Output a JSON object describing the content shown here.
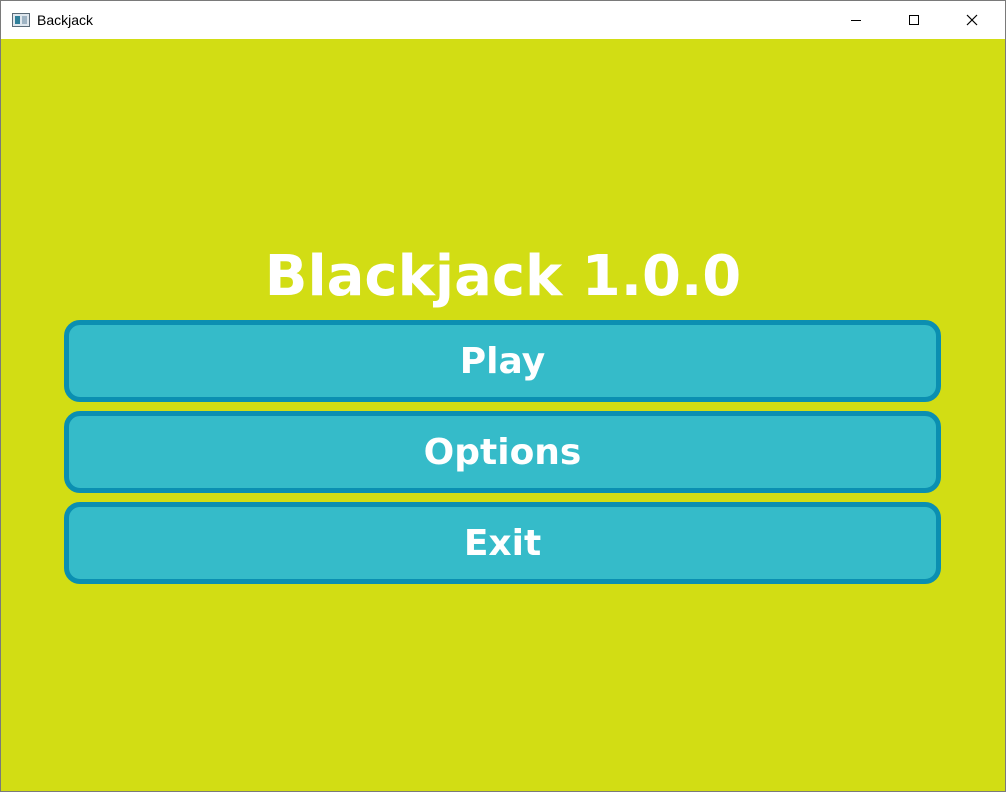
{
  "window": {
    "title": "Backjack",
    "controls": {
      "minimize_icon": "minimize-icon",
      "maximize_icon": "maximize-icon",
      "close_icon": "close-icon"
    }
  },
  "screen": {
    "title": "Blackjack 1.0.0",
    "background_color": "#d2dd14",
    "button_fill_color": "#35bbc9",
    "button_border_color": "#0b8fb1",
    "text_color": "#ffffff"
  },
  "menu": {
    "play_label": "Play",
    "options_label": "Options",
    "exit_label": "Exit"
  }
}
